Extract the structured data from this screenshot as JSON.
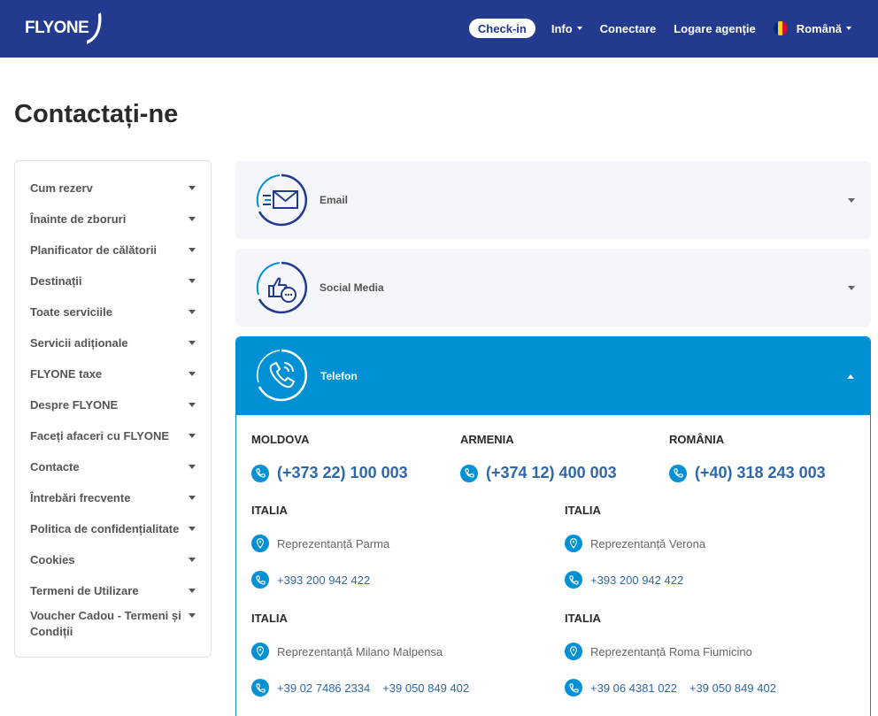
{
  "header": {
    "logo_text": "FLYONE",
    "checkin": "Check-in",
    "nav": [
      {
        "label": "Info",
        "dropdown": true
      },
      {
        "label": "Conectare",
        "dropdown": false
      },
      {
        "label": "Logare agenție",
        "dropdown": false
      }
    ],
    "language": "Română",
    "flag_colors": [
      "#002b7f",
      "#fcd116",
      "#ce1126"
    ],
    "colors": {
      "header_bg": "#233b8f",
      "accent": "#0091d5",
      "link": "#2e68a8"
    }
  },
  "page": {
    "title": "Contactați-ne"
  },
  "sidebar": {
    "items": [
      "Cum rezerv",
      "Înainte de zboruri",
      "Planificator de călătorii",
      "Destinații",
      "Toate serviciile",
      "Servicii adiționale",
      "FLYONE taxe",
      "Despre FLYONE",
      "Faceți afaceri cu FLYONE",
      "Contacte",
      "Întrebări frecvente",
      "Politica de confidențialitate",
      "Cookies",
      "Termeni de Utilizare",
      "Voucher Cadou - Termeni și Condiții"
    ]
  },
  "panels": {
    "email": {
      "label": "Email",
      "icon": "envelope-icon"
    },
    "social": {
      "label": "Social Media",
      "icon": "thumbs-up-chat-icon"
    },
    "phone": {
      "label": "Telefon",
      "icon": "phone-icon"
    }
  },
  "phones": {
    "main": [
      {
        "country": "MOLDOVA",
        "number": "(+373 22) 100 003"
      },
      {
        "country": "ARMENIA",
        "number": "(+374 12) 400 003"
      },
      {
        "country": "ROMÂNIA",
        "number": "(+40) 318 243 003"
      }
    ],
    "italy": [
      {
        "country": "ITALIA",
        "office": "Reprezentanță Parma",
        "numbers": [
          "+393 200 942 422"
        ]
      },
      {
        "country": "ITALIA",
        "office": "Reprezentanță Verona",
        "numbers": [
          "+393 200 942 422"
        ]
      },
      {
        "country": "ITALIA",
        "office": "Reprezentanță Milano Malpensa",
        "numbers": [
          "+39 02 7486 2334",
          "+39 050 849 402"
        ]
      },
      {
        "country": "ITALIA",
        "office": "Reprezentanță Roma Fiumicino",
        "numbers": [
          "+39 06 4381 022",
          "+39 050 849 402"
        ]
      }
    ]
  }
}
